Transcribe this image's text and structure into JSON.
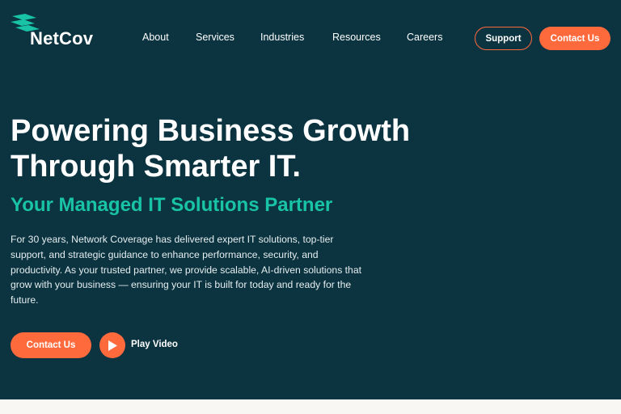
{
  "brand": {
    "name": "NetCov",
    "accent": "#ff6a3d",
    "background": "#0b3340",
    "teal": "#19c3a6",
    "logo_icon": "stacked-chevrons-logo"
  },
  "nav": {
    "items": [
      {
        "label": "About"
      },
      {
        "label": "Services"
      },
      {
        "label": "Industries"
      },
      {
        "label": "Resources"
      },
      {
        "label": "Careers"
      }
    ],
    "support_label": "Support",
    "contact_label": "Contact Us"
  },
  "hero": {
    "title_line1": "Powering Business Growth",
    "title_line2": "Through Smarter IT.",
    "subtitle": "Your Managed IT Solutions Partner",
    "body": "For 30 years, Network Coverage has delivered expert IT solutions, top-tier support, and strategic guidance to enhance performance, security, and productivity. As your trusted partner, we provide scalable, AI-driven solutions that grow with your business — ensuring your IT is built for today and ready for the future.",
    "cta_contact_label": "Contact Us",
    "cta_play_label": "Play Video",
    "play_icon": "play-icon"
  }
}
